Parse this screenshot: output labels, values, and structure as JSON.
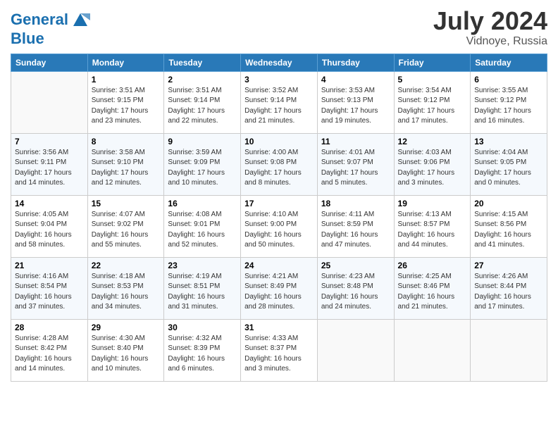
{
  "header": {
    "logo_line1": "General",
    "logo_line2": "Blue",
    "month_year": "July 2024",
    "location": "Vidnoye, Russia"
  },
  "weekdays": [
    "Sunday",
    "Monday",
    "Tuesday",
    "Wednesday",
    "Thursday",
    "Friday",
    "Saturday"
  ],
  "weeks": [
    [
      {
        "day": "",
        "info": ""
      },
      {
        "day": "1",
        "info": "Sunrise: 3:51 AM\nSunset: 9:15 PM\nDaylight: 17 hours\nand 23 minutes."
      },
      {
        "day": "2",
        "info": "Sunrise: 3:51 AM\nSunset: 9:14 PM\nDaylight: 17 hours\nand 22 minutes."
      },
      {
        "day": "3",
        "info": "Sunrise: 3:52 AM\nSunset: 9:14 PM\nDaylight: 17 hours\nand 21 minutes."
      },
      {
        "day": "4",
        "info": "Sunrise: 3:53 AM\nSunset: 9:13 PM\nDaylight: 17 hours\nand 19 minutes."
      },
      {
        "day": "5",
        "info": "Sunrise: 3:54 AM\nSunset: 9:12 PM\nDaylight: 17 hours\nand 17 minutes."
      },
      {
        "day": "6",
        "info": "Sunrise: 3:55 AM\nSunset: 9:12 PM\nDaylight: 17 hours\nand 16 minutes."
      }
    ],
    [
      {
        "day": "7",
        "info": "Sunrise: 3:56 AM\nSunset: 9:11 PM\nDaylight: 17 hours\nand 14 minutes."
      },
      {
        "day": "8",
        "info": "Sunrise: 3:58 AM\nSunset: 9:10 PM\nDaylight: 17 hours\nand 12 minutes."
      },
      {
        "day": "9",
        "info": "Sunrise: 3:59 AM\nSunset: 9:09 PM\nDaylight: 17 hours\nand 10 minutes."
      },
      {
        "day": "10",
        "info": "Sunrise: 4:00 AM\nSunset: 9:08 PM\nDaylight: 17 hours\nand 8 minutes."
      },
      {
        "day": "11",
        "info": "Sunrise: 4:01 AM\nSunset: 9:07 PM\nDaylight: 17 hours\nand 5 minutes."
      },
      {
        "day": "12",
        "info": "Sunrise: 4:03 AM\nSunset: 9:06 PM\nDaylight: 17 hours\nand 3 minutes."
      },
      {
        "day": "13",
        "info": "Sunrise: 4:04 AM\nSunset: 9:05 PM\nDaylight: 17 hours\nand 0 minutes."
      }
    ],
    [
      {
        "day": "14",
        "info": "Sunrise: 4:05 AM\nSunset: 9:04 PM\nDaylight: 16 hours\nand 58 minutes."
      },
      {
        "day": "15",
        "info": "Sunrise: 4:07 AM\nSunset: 9:02 PM\nDaylight: 16 hours\nand 55 minutes."
      },
      {
        "day": "16",
        "info": "Sunrise: 4:08 AM\nSunset: 9:01 PM\nDaylight: 16 hours\nand 52 minutes."
      },
      {
        "day": "17",
        "info": "Sunrise: 4:10 AM\nSunset: 9:00 PM\nDaylight: 16 hours\nand 50 minutes."
      },
      {
        "day": "18",
        "info": "Sunrise: 4:11 AM\nSunset: 8:59 PM\nDaylight: 16 hours\nand 47 minutes."
      },
      {
        "day": "19",
        "info": "Sunrise: 4:13 AM\nSunset: 8:57 PM\nDaylight: 16 hours\nand 44 minutes."
      },
      {
        "day": "20",
        "info": "Sunrise: 4:15 AM\nSunset: 8:56 PM\nDaylight: 16 hours\nand 41 minutes."
      }
    ],
    [
      {
        "day": "21",
        "info": "Sunrise: 4:16 AM\nSunset: 8:54 PM\nDaylight: 16 hours\nand 37 minutes."
      },
      {
        "day": "22",
        "info": "Sunrise: 4:18 AM\nSunset: 8:53 PM\nDaylight: 16 hours\nand 34 minutes."
      },
      {
        "day": "23",
        "info": "Sunrise: 4:19 AM\nSunset: 8:51 PM\nDaylight: 16 hours\nand 31 minutes."
      },
      {
        "day": "24",
        "info": "Sunrise: 4:21 AM\nSunset: 8:49 PM\nDaylight: 16 hours\nand 28 minutes."
      },
      {
        "day": "25",
        "info": "Sunrise: 4:23 AM\nSunset: 8:48 PM\nDaylight: 16 hours\nand 24 minutes."
      },
      {
        "day": "26",
        "info": "Sunrise: 4:25 AM\nSunset: 8:46 PM\nDaylight: 16 hours\nand 21 minutes."
      },
      {
        "day": "27",
        "info": "Sunrise: 4:26 AM\nSunset: 8:44 PM\nDaylight: 16 hours\nand 17 minutes."
      }
    ],
    [
      {
        "day": "28",
        "info": "Sunrise: 4:28 AM\nSunset: 8:42 PM\nDaylight: 16 hours\nand 14 minutes."
      },
      {
        "day": "29",
        "info": "Sunrise: 4:30 AM\nSunset: 8:40 PM\nDaylight: 16 hours\nand 10 minutes."
      },
      {
        "day": "30",
        "info": "Sunrise: 4:32 AM\nSunset: 8:39 PM\nDaylight: 16 hours\nand 6 minutes."
      },
      {
        "day": "31",
        "info": "Sunrise: 4:33 AM\nSunset: 8:37 PM\nDaylight: 16 hours\nand 3 minutes."
      },
      {
        "day": "",
        "info": ""
      },
      {
        "day": "",
        "info": ""
      },
      {
        "day": "",
        "info": ""
      }
    ]
  ]
}
